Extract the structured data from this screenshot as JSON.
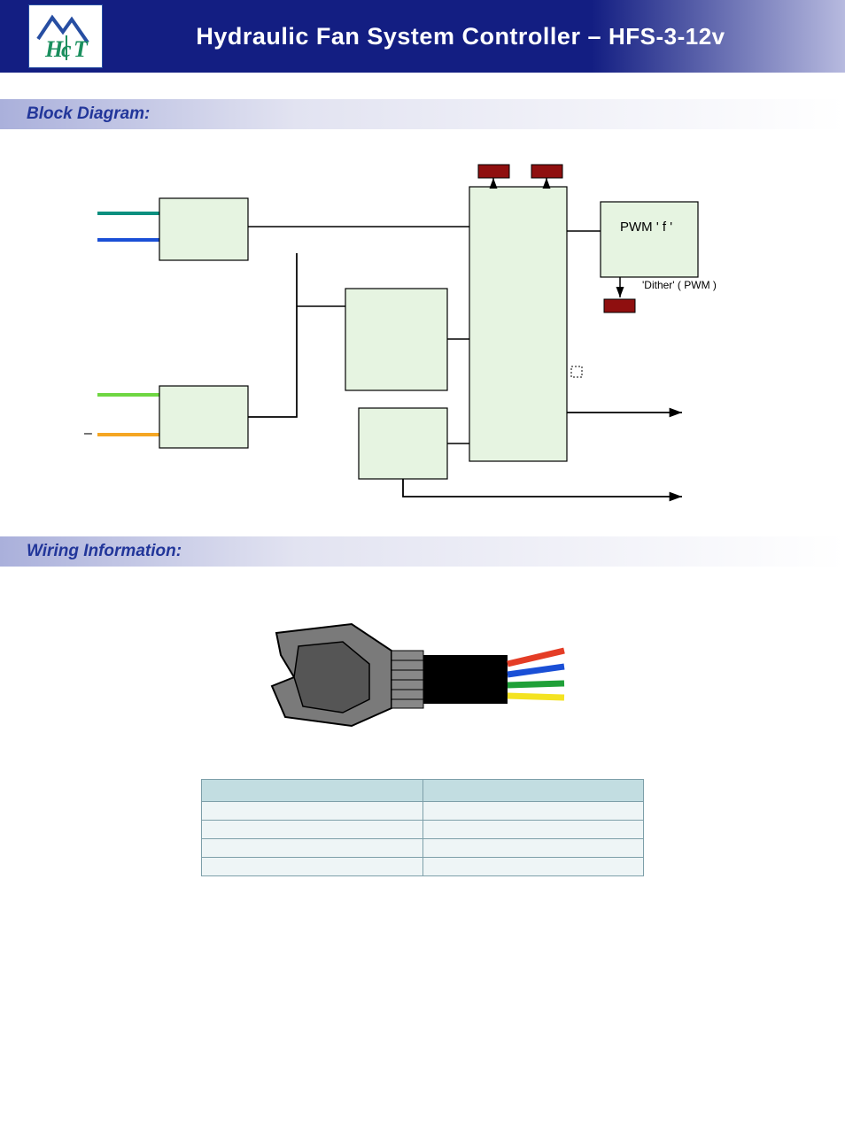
{
  "header": {
    "title_main": "Hydraulic Fan System Controller",
    "title_sep": " – ",
    "title_model": "HFS-3-12v",
    "logo_alt": "HCT"
  },
  "sections": {
    "block_diagram": "Block Diagram:",
    "wiring_info": "Wiring Information:"
  },
  "diagram": {
    "pwm_label": "PWM ' f '",
    "dither_label": "'Dither' ( PWM )",
    "dash_label": "–"
  },
  "wiring_table": {
    "headers": [
      "",
      ""
    ],
    "rows": [
      [
        "",
        ""
      ],
      [
        "",
        ""
      ],
      [
        "",
        ""
      ],
      [
        "",
        ""
      ]
    ]
  },
  "chart_data": {
    "type": "diagram",
    "title": "Block Diagram",
    "blocks": [
      {
        "id": "input-a",
        "type": "block",
        "color": "#e6f4e1"
      },
      {
        "id": "input-b",
        "type": "block",
        "color": "#e6f4e1"
      },
      {
        "id": "mid-top",
        "type": "block",
        "color": "#e6f4e1"
      },
      {
        "id": "mid-bottom",
        "type": "block",
        "color": "#e6f4e1"
      },
      {
        "id": "main",
        "type": "block",
        "color": "#e6f4e1"
      },
      {
        "id": "pwm",
        "type": "block",
        "label": "PWM ' f '",
        "color": "#e6f4e1"
      },
      {
        "id": "led1",
        "type": "indicator",
        "color": "#8f0f0f"
      },
      {
        "id": "led2",
        "type": "indicator",
        "color": "#8f0f0f"
      },
      {
        "id": "led-dither",
        "type": "indicator",
        "color": "#8f0f0f",
        "label": "'Dither' ( PWM )"
      }
    ],
    "input_wires": [
      {
        "to": "input-a",
        "color": "#0a8f7f"
      },
      {
        "to": "input-a",
        "color": "#1a4fd6"
      },
      {
        "to": "input-b",
        "color": "#6fd642"
      },
      {
        "to": "input-b",
        "color": "#f5a623"
      }
    ],
    "connections": [
      {
        "from": "input-a",
        "to": "main"
      },
      {
        "from": "input-b",
        "to": "mid-top",
        "via": "vertical"
      },
      {
        "from": "mid-top",
        "to": "main"
      },
      {
        "from": "mid-bottom",
        "to": "main"
      },
      {
        "from": "main",
        "to": "led1",
        "dir": "up"
      },
      {
        "from": "main",
        "to": "led2",
        "dir": "up"
      },
      {
        "from": "main",
        "to": "pwm"
      },
      {
        "from": "pwm",
        "to": "led-dither",
        "dir": "down"
      },
      {
        "from": "main",
        "to": "output-arrow-1"
      },
      {
        "from": "mid-bottom",
        "to": "output-arrow-2",
        "via": "down-right"
      }
    ],
    "connector_wires": [
      "#e43d26",
      "#1a4fd6",
      "#1fa038",
      "#f4e321"
    ]
  }
}
